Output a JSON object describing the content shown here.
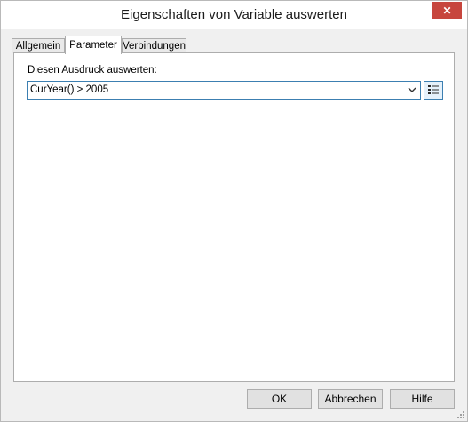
{
  "window": {
    "title": "Eigenschaften von Variable auswerten",
    "close_glyph": "✕"
  },
  "tabs": [
    {
      "label": "Allgemein",
      "active": false
    },
    {
      "label": "Parameter",
      "active": true
    },
    {
      "label": "Verbindungen",
      "active": false
    }
  ],
  "parameter": {
    "expression_label": "Diesen Ausdruck auswerten:",
    "expression_value": "CurYear() > 2005",
    "dropdown_icon": "chevron-down-icon",
    "formula_icon": "formula-editor-icon"
  },
  "buttons": {
    "ok": "OK",
    "cancel": "Abbrechen",
    "help": "Hilfe"
  },
  "colors": {
    "close_button": "#c7463e",
    "focus_border": "#3c7fb1"
  }
}
